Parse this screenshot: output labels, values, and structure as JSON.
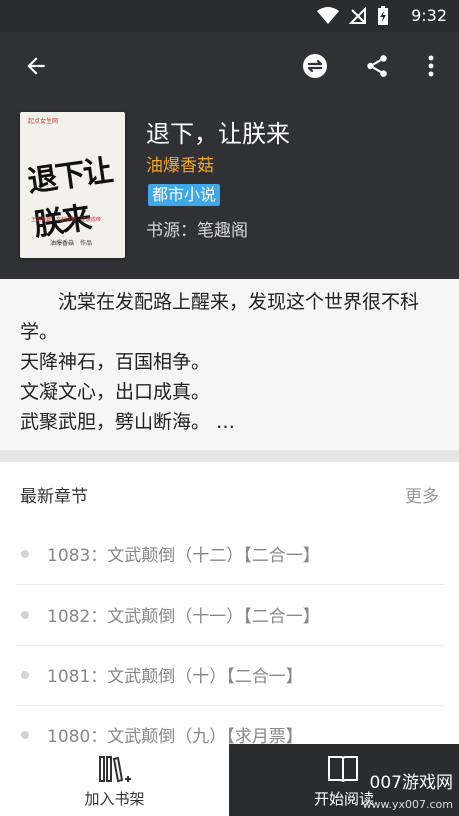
{
  "status_bar": {
    "time": "9:32"
  },
  "toolbar": {
    "back_icon": "arrow-left-icon",
    "subscribe_icon": "subscribe-icon",
    "share_icon": "share-icon",
    "more_icon": "more-vert-icon"
  },
  "book": {
    "title": "退下，让朕来",
    "author": "油爆香菇",
    "tag": "都市小说",
    "source": "书源：笔趣阁",
    "cover": {
      "brand": "起点女生网",
      "title_art": "退下让朕来",
      "tagline": "· 王朝争霸 · 文韬武略 · 逆袭成帝 ·",
      "author_line": "油爆香菇　作品"
    }
  },
  "intro": {
    "lines": [
      "沈棠在发配路上醒来，发现这个世界很不科学。",
      "天降神石，百国相争。",
      "文凝文心，出口成真。",
      "武聚武胆，劈山断海。 …"
    ]
  },
  "chapters": {
    "title": "最新章节",
    "more": "更多",
    "items": [
      "1083：文武颠倒（十二）【二合一】",
      "1082：文武颠倒（十一）【二合一】",
      "1081：文武颠倒（十）【二合一】",
      "1080：文武颠倒（九）【求月票】"
    ]
  },
  "bottom": {
    "add_shelf": "加入书架",
    "start_read": "开始阅读",
    "watermark_main": "007游戏网",
    "watermark_url": "www.yx007.com"
  },
  "colors": {
    "header_bg": "#303134",
    "author": "#f6a623",
    "tag_bg": "#3fa8ea",
    "read_btn_bg": "#2b2c2e"
  }
}
